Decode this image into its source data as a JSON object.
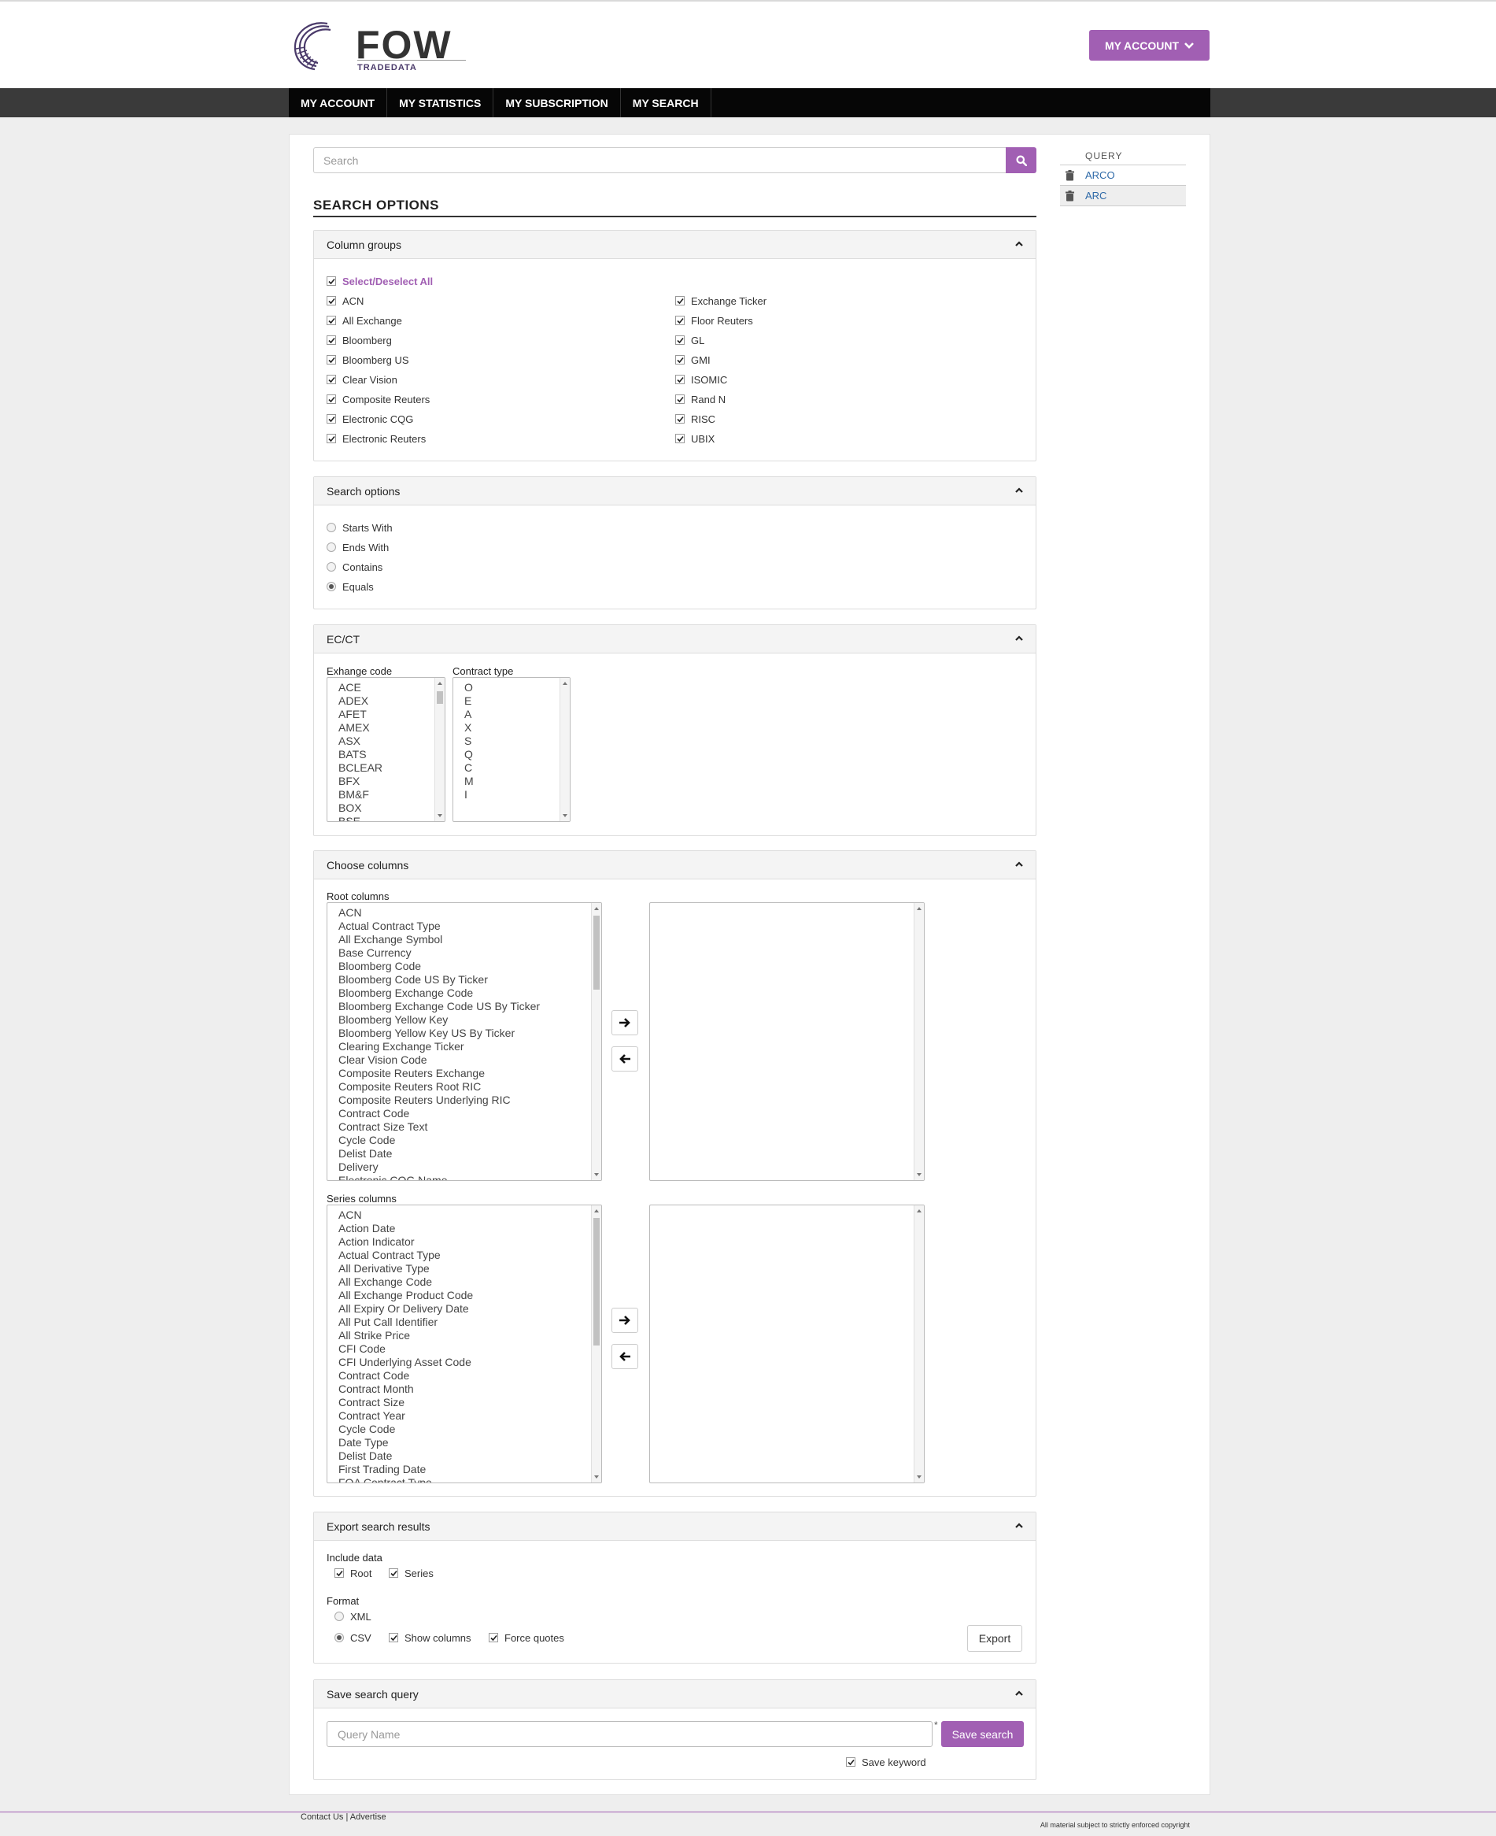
{
  "brand": {
    "name": "FOW",
    "tagline": "TRADEDATA",
    "accent_color": "#a15fb3",
    "nav_bg": "#060606"
  },
  "header": {
    "account_button": "MY ACCOUNT",
    "account_icon": "chevron-down-icon"
  },
  "nav": {
    "items": [
      "MY ACCOUNT",
      "MY STATISTICS",
      "MY SUBSCRIPTION",
      "MY SEARCH"
    ]
  },
  "search": {
    "placeholder": "Search",
    "icon": "search-icon"
  },
  "search_options_title": "SEARCH OPTIONS",
  "query_panel": {
    "title": "QUERY",
    "items": [
      "ARCO",
      "ARC"
    ]
  },
  "column_groups": {
    "title": "Column groups",
    "select_all": "Select/Deselect All",
    "left": [
      "ACN",
      "All Exchange",
      "Bloomberg",
      "Bloomberg US",
      "Clear Vision",
      "Composite Reuters",
      "Electronic CQG",
      "Electronic Reuters"
    ],
    "right": [
      "Exchange Ticker",
      "Floor Reuters",
      "GL",
      "GMI",
      "ISOMIC",
      "Rand N",
      "RISC",
      "UBIX"
    ]
  },
  "search_options": {
    "title": "Search options",
    "options": [
      "Starts With",
      "Ends With",
      "Contains",
      "Equals"
    ],
    "selected": "Equals"
  },
  "ecct": {
    "title": "EC/CT",
    "exchange_label": "Exhange code",
    "exchange_codes": [
      "ACE",
      "ADEX",
      "AFET",
      "AMEX",
      "ASX",
      "BATS",
      "BCLEAR",
      "BFX",
      "BM&F",
      "BOX",
      "BSE"
    ],
    "contract_label": "Contract type",
    "contract_types": [
      "O",
      "E",
      "A",
      "X",
      "S",
      "Q",
      "C",
      "M",
      "I"
    ]
  },
  "choose_columns": {
    "title": "Choose columns",
    "root_label": "Root columns",
    "root_columns": [
      "ACN",
      "Actual Contract Type",
      "All Exchange Symbol",
      "Base Currency",
      "Bloomberg Code",
      "Bloomberg Code US By Ticker",
      "Bloomberg Exchange Code",
      "Bloomberg Exchange Code US By Ticker",
      "Bloomberg Yellow Key",
      "Bloomberg Yellow Key US By Ticker",
      "Clearing Exchange Ticker",
      "Clear Vision Code",
      "Composite Reuters Exchange",
      "Composite Reuters Root RIC",
      "Composite Reuters Underlying RIC",
      "Contract Code",
      "Contract Size Text",
      "Cycle Code",
      "Delist Date",
      "Delivery",
      "Electronic CQG Name"
    ],
    "series_label": "Series columns",
    "series_columns": [
      "ACN",
      "Action Date",
      "Action Indicator",
      "Actual Contract Type",
      "All Derivative Type",
      "All Exchange Code",
      "All Exchange Product Code",
      "All Expiry Or Delivery Date",
      "All Put Call Identifier",
      "All Strike Price",
      "CFI Code",
      "CFI Underlying Asset Code",
      "Contract Code",
      "Contract Month",
      "Contract Size",
      "Contract Year",
      "Cycle Code",
      "Date Type",
      "Delist Date",
      "First Trading Date",
      "FOA Contract Type"
    ],
    "add_icon": "arrow-right-icon",
    "remove_icon": "arrow-left-icon"
  },
  "export": {
    "title": "Export search results",
    "include_label": "Include data",
    "root": "Root",
    "series": "Series",
    "format_label": "Format",
    "xml": "XML",
    "csv": "CSV",
    "show_columns": "Show columns",
    "force_quotes": "Force quotes",
    "export_button": "Export"
  },
  "save_query": {
    "title": "Save search query",
    "placeholder": "Query Name",
    "required_mark": "*",
    "save_button": "Save search",
    "save_keyword": "Save keyword"
  },
  "footer": {
    "contact": "Contact Us",
    "separator": "|",
    "advertise": "Advertise",
    "copyright": "All material subject to strictly enforced copyright"
  }
}
